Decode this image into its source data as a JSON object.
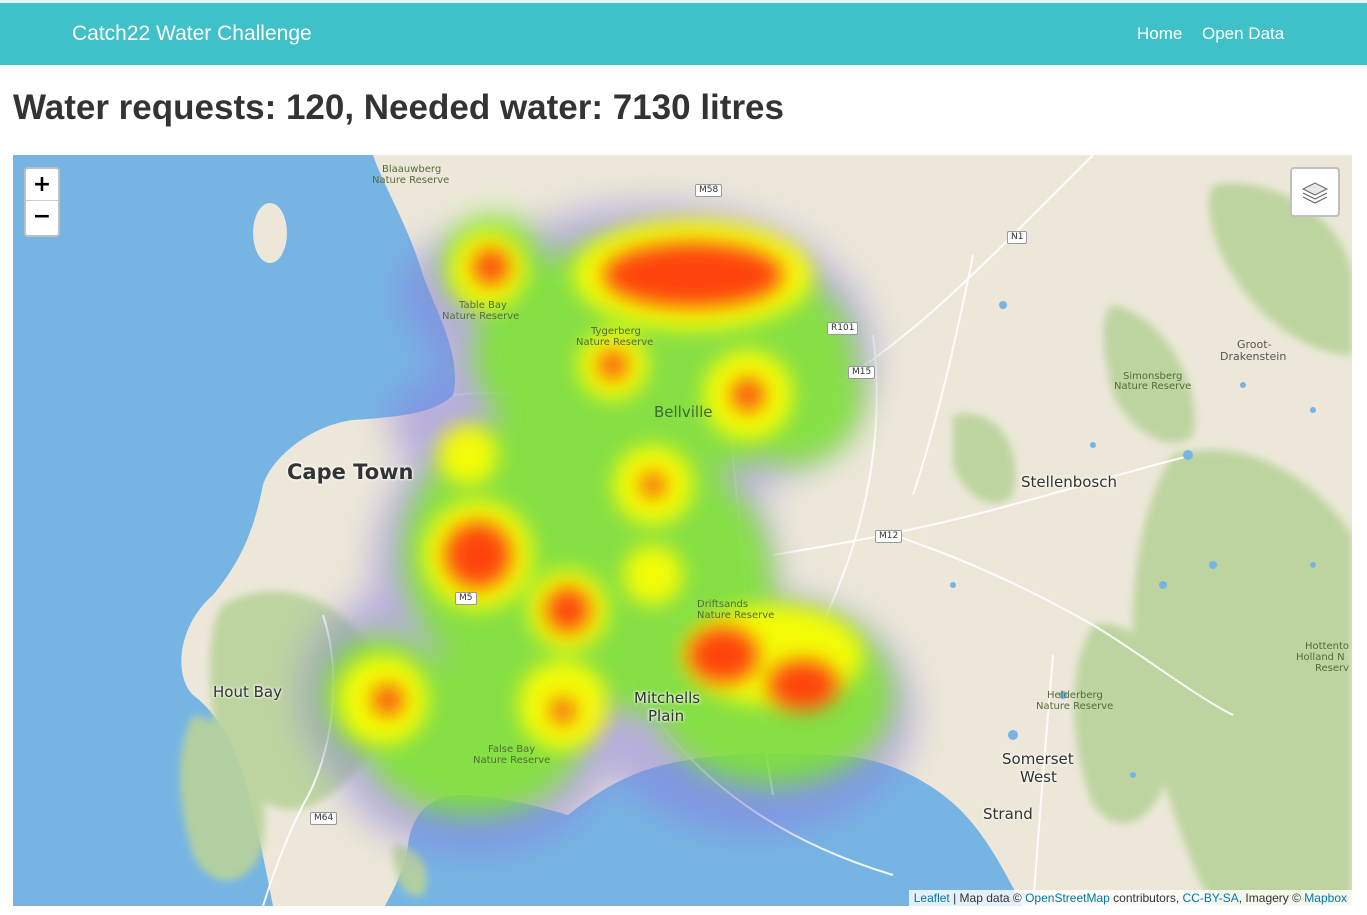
{
  "app": {
    "brand": "Catch22 Water Challenge",
    "nav": [
      "Home",
      "Open Data"
    ]
  },
  "page": {
    "title": "Water requests: 120, Needed water: 7130 litres"
  },
  "map": {
    "zoom_in": "+",
    "zoom_out": "−",
    "layers_icon": "layers-icon",
    "attribution": {
      "leaflet": "Leaflet",
      "map_data": " | Map data © ",
      "osm": "OpenStreetMap",
      "contributors": " contributors, ",
      "license": "CC-BY-SA",
      "imagery": ", Imagery © ",
      "mapbox": "Mapbox"
    },
    "places": {
      "cape_town": "Cape Town",
      "bellville": "Bellville",
      "stellenbosch": "Stellenbosch",
      "hout_bay": "Hout Bay",
      "mitchells_plain_1": "Mitchells",
      "mitchells_plain_2": "Plain",
      "somerset_1": "Somerset",
      "somerset_2": "West",
      "strand": "Strand",
      "groot_1": "Groot-",
      "groot_2": "Drakenstein",
      "blaauwberg_1": "Blaauwberg",
      "blaauwberg_2": "Nature Reserve",
      "table_bay_1": "Table Bay",
      "table_bay_2": "Nature Reserve",
      "tygerberg_1": "Tygerberg",
      "tygerberg_2": "Nature Reserve",
      "simonsberg_1": "Simonsberg",
      "simonsberg_2": "Nature Reserve",
      "helderberg_1": "Helderberg",
      "helderberg_2": "Nature Reserve",
      "false_bay_1": "False Bay",
      "false_bay_2": "Nature Reserve",
      "driftsands_1": "Driftsands",
      "driftsands_2": "Nature Reserve",
      "hottentots_1": "Hottento",
      "hottentots_2": "Holland N",
      "hottentots_3": "Reserv"
    },
    "roads": [
      "M58",
      "N1",
      "R101",
      "M15",
      "M12",
      "M5",
      "M64"
    ],
    "colors": {
      "water": "#76b5e3",
      "land": "#ece7d8",
      "vegetation": "#b9d39a",
      "heat_low": "#8a7fe0",
      "heat_mid": "#7ee82a",
      "heat_high": "#ffff00",
      "heat_max": "#ff3b0f"
    }
  }
}
